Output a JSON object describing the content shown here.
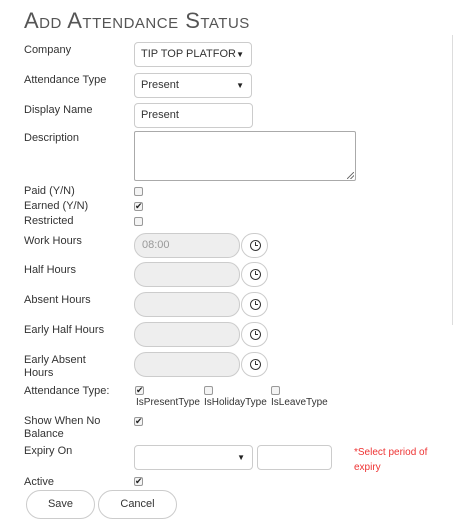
{
  "page_title": "Add Attendance Status",
  "fields": {
    "company": {
      "label": "Company",
      "value": "TIP TOP PLATFOR"
    },
    "attendance_type": {
      "label": "Attendance Type",
      "value": "Present"
    },
    "display_name": {
      "label": "Display Name",
      "value": "Present"
    },
    "description": {
      "label": "Description",
      "value": ""
    },
    "paid": {
      "label": "Paid (Y/N)",
      "checked": false
    },
    "earned": {
      "label": "Earned (Y/N)",
      "checked": true
    },
    "restricted": {
      "label": "Restricted",
      "checked": false
    },
    "work_hours": {
      "label": "Work Hours",
      "placeholder": "08:00"
    },
    "half_hours": {
      "label": "Half Hours",
      "value": ""
    },
    "absent_hours": {
      "label": "Absent Hours",
      "value": ""
    },
    "early_half_hours": {
      "label": "Early Half Hours",
      "value": ""
    },
    "early_absent_hours": {
      "label_line1": "Early Absent",
      "label_line2": "Hours",
      "value": ""
    },
    "attendance_type_flags": {
      "label": "Attendance Type:",
      "options": [
        {
          "label": "IsPresentType",
          "checked": true
        },
        {
          "label": "IsHolidayType",
          "checked": false
        },
        {
          "label": "IsLeaveType",
          "checked": false
        }
      ]
    },
    "show_when_no_balance": {
      "label_line1": "Show When No",
      "label_line2": "Balance",
      "checked": true
    },
    "expiry_on": {
      "label": "Expiry On",
      "value": "",
      "number": "",
      "error_line1": "*Select period of",
      "error_line2": "expiry"
    },
    "active": {
      "label": "Active",
      "checked": true
    }
  },
  "buttons": {
    "save": "Save",
    "cancel": "Cancel"
  },
  "glyphs": {
    "caret": "▼",
    "check": "✔"
  }
}
